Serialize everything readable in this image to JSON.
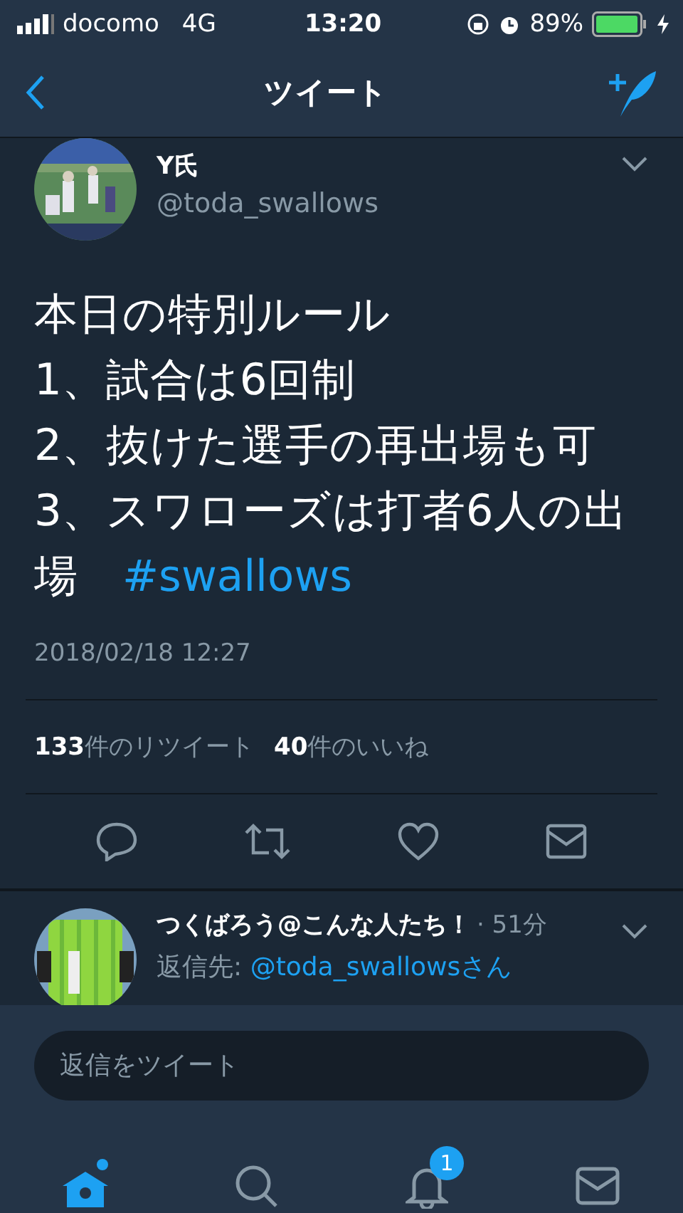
{
  "status_bar": {
    "carrier": "docomo",
    "network": "4G",
    "time": "13:20",
    "battery": "89%"
  },
  "nav": {
    "title": "ツイート"
  },
  "tweet": {
    "name": "Y氏",
    "handle": "@toda_swallows",
    "text": "本日の特別ルール\n1、試合は6回制\n2、抜けた選手の再出場も可\n3、スワローズは打者6人の出場　",
    "hashtag": "#swallows",
    "timestamp": "2018/02/18 12:27",
    "stats": [
      {
        "count": "133",
        "label": "件のリツイート"
      },
      {
        "count": "40",
        "label": "件のいいね"
      }
    ]
  },
  "reply": {
    "name": "つくばろう@こんな人たち！",
    "time": "· 51分",
    "reply_to_label": "返信先:",
    "reply_to": "@toda_swallowsさん"
  },
  "composer": {
    "placeholder": "返信をツイート"
  },
  "tab_bar": [
    {
      "kind": "home",
      "selected": true
    },
    {
      "kind": "search",
      "selected": false
    },
    {
      "kind": "notifications",
      "selected": false,
      "badge": "1"
    },
    {
      "kind": "messages",
      "selected": false
    }
  ]
}
